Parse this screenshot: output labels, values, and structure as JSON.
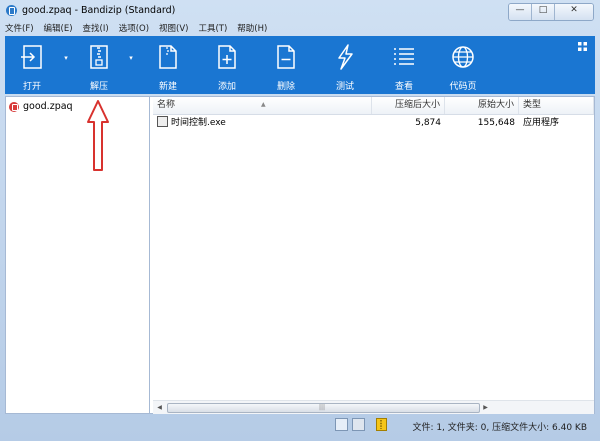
{
  "window": {
    "title": "good.zpaq - Bandizip (Standard)"
  },
  "window_controls": {
    "minimize": "—",
    "maximize": "□",
    "close": "✕"
  },
  "menu": [
    "文件(F)",
    "编辑(E)",
    "查找(I)",
    "选项(O)",
    "视图(V)",
    "工具(T)",
    "帮助(H)"
  ],
  "toolbar": {
    "open": "打开",
    "extract": "解压",
    "new": "新建",
    "add": "添加",
    "delete": "删除",
    "test": "测试",
    "view": "查看",
    "codepage": "代码页"
  },
  "sidebar": {
    "archive_name": "good.zpaq"
  },
  "columns": {
    "name": "名称",
    "packed_size": "压缩后大小",
    "original_size": "原始大小",
    "type": "类型"
  },
  "files": [
    {
      "name": "时间控制.exe",
      "packed_size": "5,874",
      "original_size": "155,648",
      "type": "应用程序"
    }
  ],
  "status": {
    "text": "文件: 1, 文件夹: 0, 压缩文件大小: 6.40 KB"
  },
  "icons": {
    "app": "bandizip-app-icon",
    "open": "open-arrow-icon",
    "extract": "zip-extract-icon",
    "new": "new-file-icon",
    "add": "add-file-icon",
    "delete": "delete-file-icon",
    "test": "lightning-test-icon",
    "view": "list-view-icon",
    "codepage": "globe-icon",
    "annotation": "red-arrow-annotation"
  },
  "colors": {
    "toolbar_bg": "#1a76d2",
    "annotation": "#d8322e"
  }
}
